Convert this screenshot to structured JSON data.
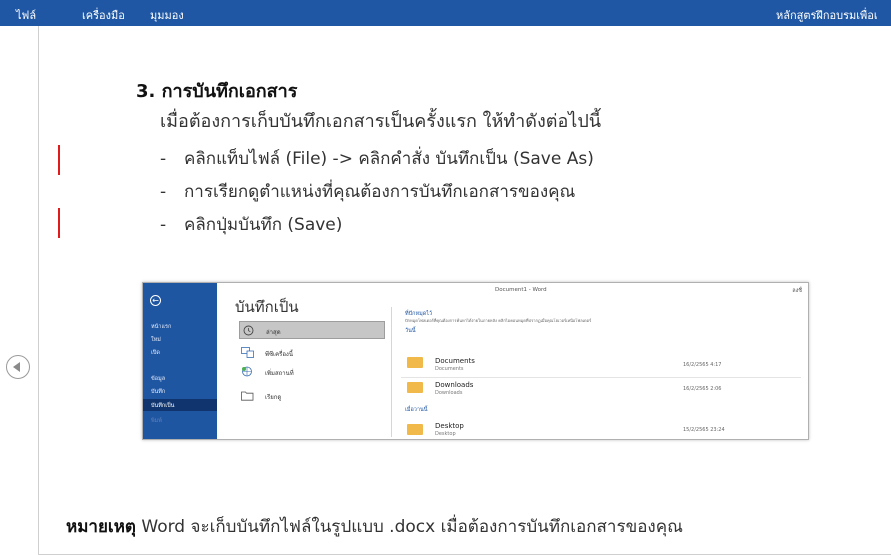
{
  "menubar": {
    "items": [
      "ไฟล์",
      "เครื่องมือ",
      "มุมมอง"
    ],
    "course_title": "หลักสูตรฝึกอบรมเพื่อเ"
  },
  "content": {
    "heading": "3. การบันทึกเอกสาร",
    "intro": "เมื่อต้องการเก็บบันทึกเอกสารเป็นครั้งแรก ให้ทำดังต่อไปนี้",
    "steps": [
      "คลิกแท็บไฟล์ (File) -> คลิกคำสั่ง บันทึกเป็น (Save As)",
      "การเรียกดูตำแหน่งที่คุณต้องการบันทึกเอกสารของคุณ",
      "คลิกปุ่มบันทึก (Save)"
    ],
    "note_bold": "หมายเหตุ",
    "note_text": " Word จะเก็บบันทึกไฟล์ในรูปแบบ .docx เมื่อต้องการบันทึกเอกสารของคุณ"
  },
  "screenshot": {
    "window_title": "Document1 - Word",
    "user": "ลงชื่",
    "title": "บันทึกเป็น",
    "left_items": [
      "หน้าแรก",
      "ใหม่",
      "เปิด",
      "ข้อมูล",
      "บันทึก",
      "บันทึกเป็น",
      "พิมพ์"
    ],
    "locations": [
      "ล่าสุด",
      "พีซีเครื่องนี้",
      "เพิ่มสถานที่",
      "เรียกดู"
    ],
    "pinned_header": "ที่ปักหมุดไว้",
    "pinned_desc": "ปักหมุดโฟลเดอร์ที่คุณต้องการค้นหาได้ง่ายในภายหลัง คลิกไอคอนหมุดที่ปรากฏเมื่อคุณโฮเวอร์เหนือโฟลเดอร์",
    "today_label": "วันนี้",
    "yesterday_label": "เมื่อวานนี้",
    "folders": [
      {
        "name": "Documents",
        "path": "Documents",
        "date": "16/2/2565 4:17"
      },
      {
        "name": "Downloads",
        "path": "Downloads",
        "date": "16/2/2565 2:06"
      },
      {
        "name": "Desktop",
        "path": "Desktop",
        "date": "15/2/2565 23:24"
      }
    ]
  },
  "colors": {
    "menubar": "#1f57a4",
    "accent_red": "#e11b1b",
    "word_blue": "#1f56a2",
    "folder": "#f0b94a"
  },
  "icons": [
    "previous-slide-icon",
    "clock-icon",
    "computer-icon",
    "globe-add-icon",
    "folder-open-icon",
    "folder-icon"
  ]
}
